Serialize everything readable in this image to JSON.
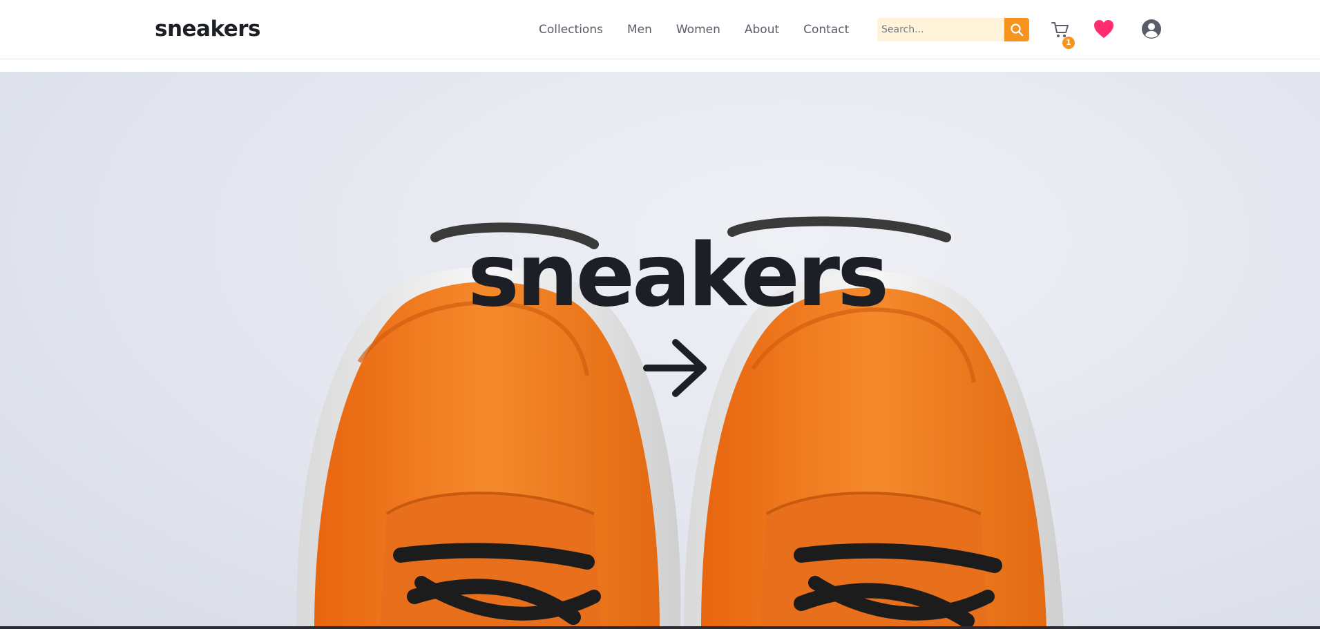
{
  "header": {
    "logo_text": "sneakers",
    "nav": {
      "collections": "Collections",
      "men": "Men",
      "women": "Women",
      "about": "About",
      "contact": "Contact"
    },
    "search": {
      "placeholder": "Search...",
      "icon": "search-icon"
    },
    "cart": {
      "icon": "cart-icon",
      "count": "1"
    },
    "wishlist": {
      "icon": "heart-icon"
    },
    "account": {
      "icon": "user-icon"
    }
  },
  "hero": {
    "title": "sneakers",
    "arrow_icon": "arrow-right-icon",
    "image": "orange-sneakers-photo"
  },
  "colors": {
    "accent": "#f7941d",
    "heart": "#ff2d6f",
    "text_dark": "#1d1f26",
    "nav_text": "#5a5d68",
    "search_bg": "#fff4d9",
    "shoe_orange": "#f07a1a"
  }
}
